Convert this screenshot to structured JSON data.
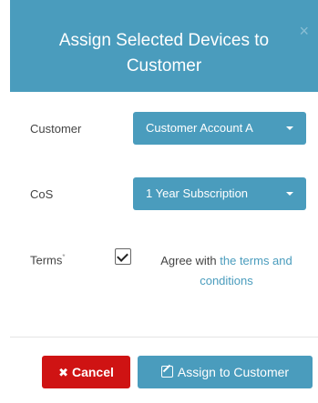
{
  "dialog": {
    "title": "Assign Selected Devices to Customer",
    "close_glyph": "×"
  },
  "form": {
    "customer_label": "Customer",
    "customer_value": "Customer Account A",
    "cos_label": "CoS",
    "cos_value": "1 Year Subscription",
    "terms_label": "Terms",
    "terms_required_mark": "*",
    "terms_checked": true,
    "terms_prefix": "Agree with ",
    "terms_link": "the terms and conditions"
  },
  "footer": {
    "cancel_icon": "✖",
    "cancel_label": "Cancel",
    "assign_label": "Assign to Customer"
  },
  "colors": {
    "primary": "#4a9cbd",
    "danger": "#cf1313"
  },
  "icons": [
    "close-icon",
    "caret-down-icon",
    "checkmark-icon",
    "times-icon",
    "edit-icon"
  ]
}
